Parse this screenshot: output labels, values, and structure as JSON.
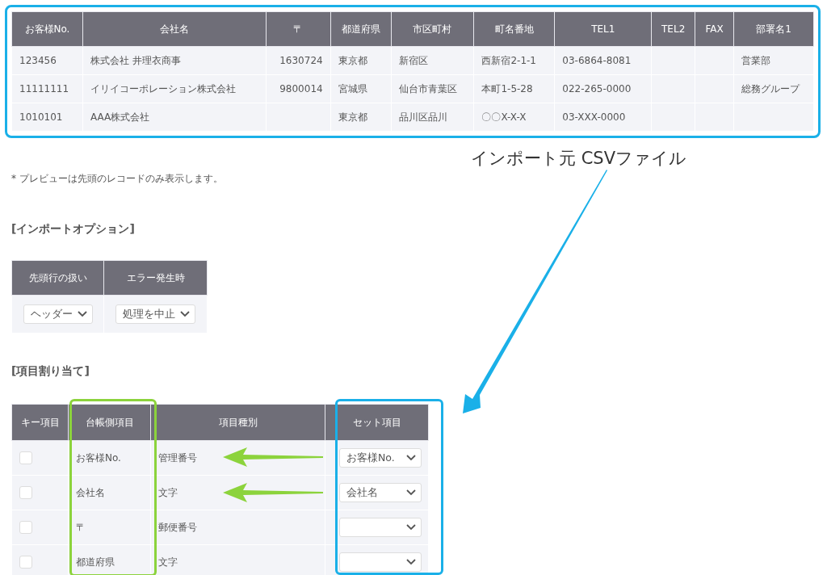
{
  "preview_table": {
    "columns": [
      "お客様No.",
      "会社名",
      "〒",
      "都道府県",
      "市区町村",
      "町名番地",
      "TEL1",
      "TEL2",
      "FAX",
      "部署名1"
    ],
    "rows": [
      [
        "123456",
        "株式会社 井理衣商事",
        "1630724",
        "東京都",
        "新宿区",
        "西新宿2-1-1",
        "03-6864-8081",
        null,
        null,
        "営業部"
      ],
      [
        "11111111",
        "イリイコーポレーション株式会社",
        "9800014",
        "宮城県",
        "仙台市青葉区",
        "本町1-5-28",
        "022-265-0000",
        null,
        null,
        "総務グループ"
      ],
      [
        "1010101",
        "AAA株式会社",
        null,
        "東京都",
        "品川区品川",
        "〇〇X-X-X",
        "03-XXX-0000",
        null,
        null,
        null
      ]
    ]
  },
  "annotation": {
    "caption": "インポート元 CSVファイル"
  },
  "note": "* プレビューは先頭のレコードのみ表示します。",
  "import_options": {
    "heading": "[インポートオプション]",
    "columns": [
      "先頭行の扱い",
      "エラー発生時"
    ],
    "values": [
      "ヘッダー",
      "処理を中止"
    ]
  },
  "field_mapping": {
    "heading": "[項目割り当て]",
    "columns": [
      "キー項目",
      "台帳側項目",
      "項目種別",
      "セット項目"
    ],
    "rows": [
      {
        "checked": false,
        "field": "お客様No.",
        "type": "管理番号",
        "set_value": "お客様No.",
        "arrow": true
      },
      {
        "checked": false,
        "field": "会社名",
        "type": "文字",
        "set_value": "会社名",
        "arrow": true
      },
      {
        "checked": false,
        "field": "〒",
        "type": "郵便番号",
        "arrow": false
      },
      {
        "checked": false,
        "field": "都道府県",
        "type": "文字",
        "arrow": false
      }
    ]
  }
}
